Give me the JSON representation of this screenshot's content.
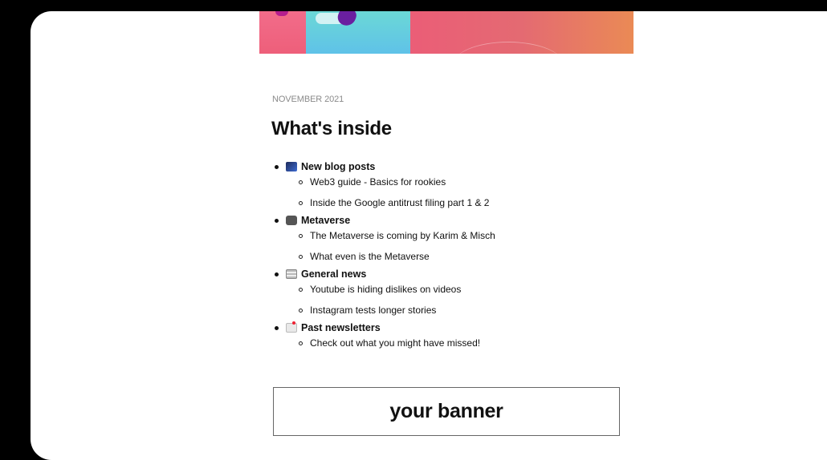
{
  "header": {
    "date": "NOVEMBER 2021",
    "title": "What's inside"
  },
  "sections": [
    {
      "icon": "chart-emoji-icon",
      "title": "New blog posts",
      "items": [
        "Web3 guide - Basics for rookies",
        "Inside the Google antitrust filing part 1 & 2"
      ]
    },
    {
      "icon": "camera-emoji-icon",
      "title": "Metaverse",
      "items": [
        "The Metaverse is coming by Karim & Misch",
        "What even is the Metaverse"
      ]
    },
    {
      "icon": "newspaper-emoji-icon",
      "title": "General news",
      "items": [
        "Youtube is hiding dislikes on videos",
        "Instagram tests longer stories"
      ]
    },
    {
      "icon": "mailbox-emoji-icon",
      "title": "Past newsletters",
      "items": [
        "Check out what you might have missed!"
      ]
    }
  ],
  "banner": {
    "label": "your banner"
  }
}
